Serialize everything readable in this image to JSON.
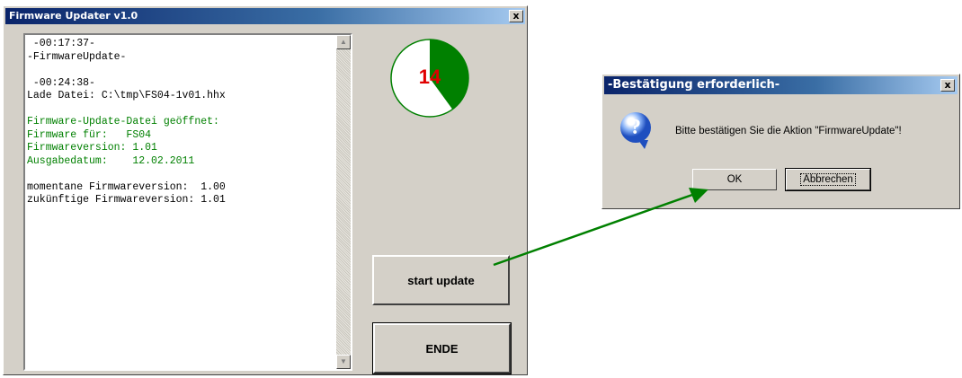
{
  "main_window": {
    "title": "Firmware Updater v1.0",
    "close_label": "x",
    "log_lines": [
      {
        "text": " -00:17:37-",
        "color": "black"
      },
      {
        "text": "-FirmwareUpdate-",
        "color": "black"
      },
      {
        "text": "",
        "color": "black"
      },
      {
        "text": " -00:24:38-",
        "color": "black"
      },
      {
        "text": "Lade Datei: C:\\tmp\\FS04-1v01.hhx",
        "color": "black"
      },
      {
        "text": "",
        "color": "black"
      },
      {
        "text": "Firmware-Update-Datei geöffnet:",
        "color": "green"
      },
      {
        "text": "Firmware für:   FS04",
        "color": "green"
      },
      {
        "text": "Firmwareversion: 1.01",
        "color": "green"
      },
      {
        "text": "Ausgabedatum:    12.02.2011",
        "color": "green"
      },
      {
        "text": "",
        "color": "black"
      },
      {
        "text": "momentane Firmwareversion:  1.00",
        "color": "black"
      },
      {
        "text": "zukünftige Firmwareversion: 1.01",
        "color": "black"
      }
    ],
    "progress": {
      "value": "14",
      "fraction": 0.4,
      "fill_color": "#008000",
      "text_color": "#e00000"
    },
    "start_button": "start update",
    "end_button": "ENDE"
  },
  "dialog": {
    "title": "-Bestätigung erforderlich-",
    "close_label": "x",
    "icon": "question-icon",
    "message": "Bitte bestätigen Sie die Aktion \"FirmwareUpdate\"!",
    "ok_button": "OK",
    "cancel_button": "Abbrechen"
  },
  "annotation": {
    "arrow_color": "#008000"
  }
}
